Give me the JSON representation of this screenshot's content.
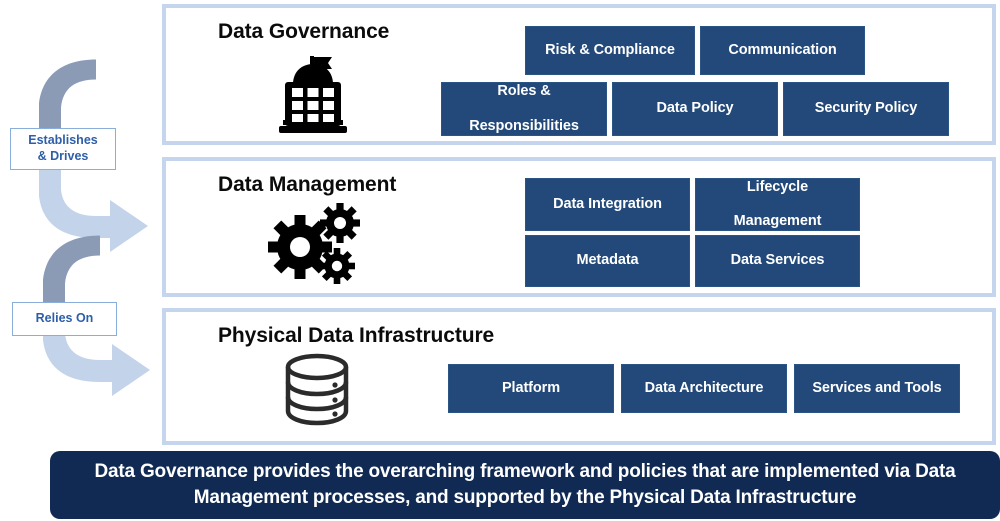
{
  "diagram": {
    "title_semantic": "data-governance-management-infrastructure-pyramid",
    "colors": {
      "box_blue": "#22497A",
      "panel_border": "#C5D5EE",
      "banner_navy": "#102A54",
      "label_text_blue": "#2E5EA8",
      "arrow_dark": "#8C9BB5",
      "arrow_light": "#C3D3EA"
    }
  },
  "connectors": [
    {
      "id": "establishes-drives",
      "label": "Establishes\n& Drives",
      "line1": "Establishes",
      "line2": "& Drives",
      "icon": "curved-arrow-icon",
      "from": "Data Governance",
      "to": "Data Management"
    },
    {
      "id": "relies-on",
      "label": "Relies On",
      "line1": "Relies On",
      "line2": "",
      "icon": "curved-arrow-icon",
      "from": "Data Management",
      "to": "Physical Data Infrastructure"
    }
  ],
  "panels": [
    {
      "id": "governance",
      "title": "Data Governance",
      "icon": "government-building-icon",
      "boxes": [
        {
          "label": "Risk & Compliance",
          "line1": "Risk & Compliance",
          "line2": ""
        },
        {
          "label": "Communication",
          "line1": "Communication",
          "line2": ""
        },
        {
          "label": "Roles & Responsibilities",
          "line1": "Roles &",
          "line2": "Responsibilities"
        },
        {
          "label": "Data Policy",
          "line1": "Data Policy",
          "line2": ""
        },
        {
          "label": "Security Policy",
          "line1": "Security Policy",
          "line2": ""
        }
      ]
    },
    {
      "id": "management",
      "title": "Data Management",
      "icon": "gears-icon",
      "boxes": [
        {
          "label": "Data Integration",
          "line1": "Data Integration",
          "line2": ""
        },
        {
          "label": "Lifecycle Management",
          "line1": "Lifecycle",
          "line2": "Management"
        },
        {
          "label": "Metadata",
          "line1": "Metadata",
          "line2": ""
        },
        {
          "label": "Data Services",
          "line1": "Data Services",
          "line2": ""
        }
      ]
    },
    {
      "id": "infrastructure",
      "title": "Physical Data Infrastructure",
      "icon": "database-cylinder-icon",
      "boxes": [
        {
          "label": "Platform",
          "line1": "Platform",
          "line2": ""
        },
        {
          "label": "Data Architecture",
          "line1": "Data Architecture",
          "line2": ""
        },
        {
          "label": "Services and Tools",
          "line1": "Services and Tools",
          "line2": ""
        }
      ]
    }
  ],
  "banner": {
    "line1": "Data Governance provides the overarching framework and policies that are implemented via",
    "line2": "Data Management processes, and supported by the Physical Data Infrastructure"
  }
}
